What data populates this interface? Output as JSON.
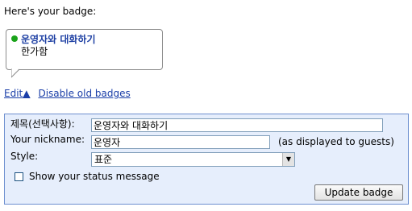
{
  "intro_text": "Here's your badge:",
  "badge": {
    "name": "운영자와 대화하기",
    "status": "한가함",
    "status_color": "#1aa31a"
  },
  "links": {
    "edit": "Edit▲",
    "disable_old": "Disable old badges"
  },
  "form": {
    "title_label": "제목(선택사항):",
    "title_value": "운영자와 대화하기",
    "nickname_label": "Your nickname:",
    "nickname_value": "운영자",
    "nickname_note": "(as displayed to guests)",
    "style_label": "Style:",
    "style_value": "표준",
    "show_status_label": "Show your status message",
    "show_status_checked": false,
    "update_button": "Update badge"
  }
}
